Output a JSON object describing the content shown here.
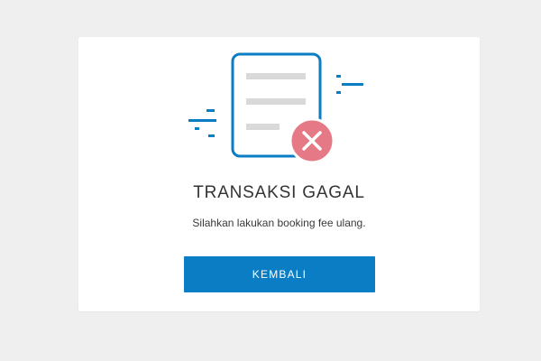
{
  "result": {
    "title": "TRANSAKSI GAGAL",
    "message": "Silahkan lakukan booking fee ulang.",
    "button_label": "KEMBALI",
    "illustration_icon": "failed-document-icon"
  },
  "colors": {
    "background": "#efefef",
    "card": "#ffffff",
    "accent_blue": "#0b7dc4",
    "error_badge": "#e57a86",
    "text": "#333333"
  }
}
